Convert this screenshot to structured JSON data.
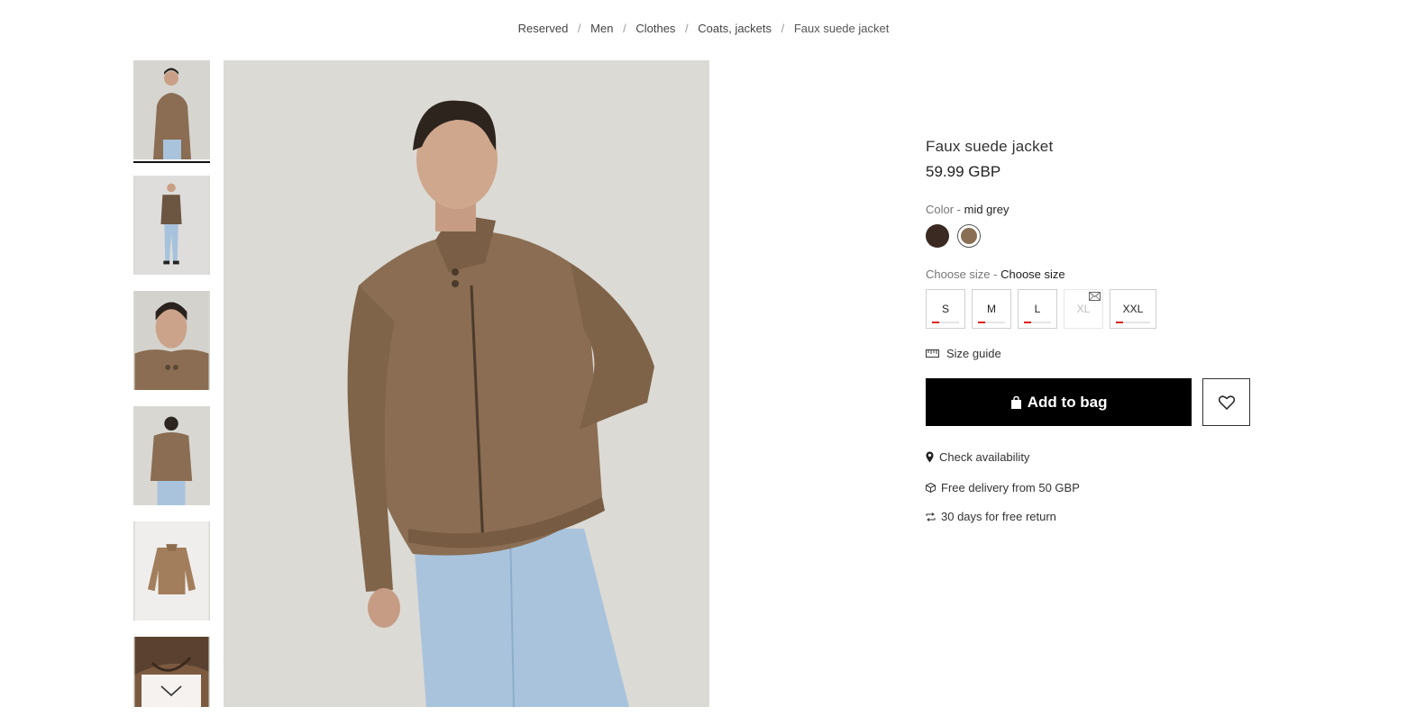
{
  "breadcrumb": {
    "items": [
      "Reserved",
      "Men",
      "Clothes",
      "Coats, jackets"
    ],
    "current": "Faux suede jacket",
    "separator": "/"
  },
  "gallery": {
    "thumbnails": [
      {
        "alt": "front view"
      },
      {
        "alt": "full body view"
      },
      {
        "alt": "collar close-up"
      },
      {
        "alt": "back view"
      },
      {
        "alt": "flat lay"
      },
      {
        "alt": "detail close-up"
      }
    ],
    "scroll_icon": "chevron-down-icon"
  },
  "product": {
    "title": "Faux suede jacket",
    "price": "59.99 GBP",
    "color_label": "Color - ",
    "color_value": "mid grey",
    "colors": [
      {
        "hex": "#3a2a22"
      },
      {
        "hex": "#8a6f55",
        "selected": true
      }
    ],
    "size_label": "Choose size - ",
    "size_value": "Choose size",
    "sizes": [
      {
        "label": "S",
        "available": true
      },
      {
        "label": "M",
        "available": true
      },
      {
        "label": "L",
        "available": true
      },
      {
        "label": "XL",
        "available": false
      },
      {
        "label": "XXL",
        "available": true
      }
    ],
    "size_guide": "Size guide",
    "add_to_bag": "Add to bag",
    "check_availability": "Check availability",
    "free_delivery": "Free delivery from 50 GBP",
    "free_return": "30 days for free return"
  },
  "colors": {
    "primary_button": "#000000",
    "stock_indicator": "#e0201c",
    "jacket": "#8a6f55"
  }
}
